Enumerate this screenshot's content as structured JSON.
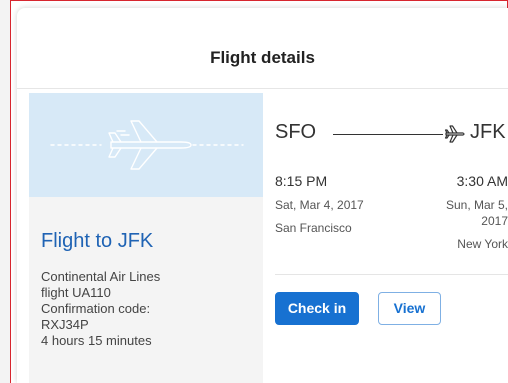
{
  "header": {
    "title": "Flight details"
  },
  "flight": {
    "title": "Flight to JFK",
    "airline": "Continental Air Lines",
    "flight_number": "flight UA110",
    "confirmation_label": "Confirmation code:",
    "confirmation_code": "RXJ34P",
    "duration": "4 hours 15 minutes"
  },
  "route": {
    "origin": "SFO",
    "destination": "JFK",
    "icon": "airplane-icon"
  },
  "departure": {
    "time": "8:15 PM",
    "date": "Sat, Mar 4, 2017",
    "city": "San Francisco"
  },
  "arrival": {
    "time": "3:30 AM",
    "date": "Sun, Mar 5, 2017",
    "city": "New York"
  },
  "actions": {
    "check_in": "Check in",
    "view": "View"
  },
  "colors": {
    "accent": "#1771d1",
    "hero_bg": "#d7e9f7",
    "frame_border": "#d7262f"
  }
}
